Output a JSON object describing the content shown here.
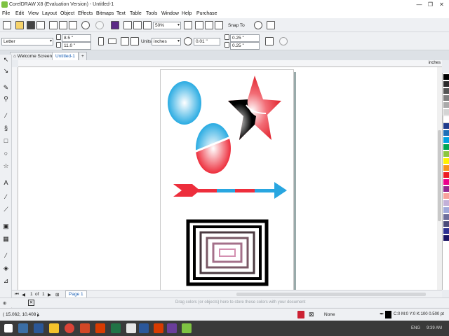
{
  "window": {
    "title": "CorelDRAW X8 (Evaluation Version) - Untitled-1",
    "minimize": "—",
    "maximize": "❐",
    "close": "✕"
  },
  "menu": [
    "File",
    "Edit",
    "View",
    "Layout",
    "Object",
    "Effects",
    "Bitmaps",
    "Text",
    "Table",
    "Tools",
    "Window",
    "Help",
    "Purchase"
  ],
  "toolbar": {
    "zoom": "50%",
    "snap_to": "Snap To"
  },
  "property_bar": {
    "page_size": "Letter",
    "width": "8.5 \"",
    "height": "11.0 \"",
    "units_label": "Units:",
    "units": "inches",
    "nudge": "0.01 \"",
    "dup_x": "0.25 \"",
    "dup_y": "0.25 \""
  },
  "tabs": {
    "welcome": "Welcome Screen",
    "document": "Untitled-1",
    "add": "+"
  },
  "ruler": {
    "unit_label": "inches"
  },
  "page_nav": {
    "current": "1",
    "of_label": "of",
    "total": "1",
    "page_tab": "Page 1"
  },
  "colorbar": {
    "hint": "Drag colors (or objects) here to store these colors with your document"
  },
  "status": {
    "coordinates": "( 15.062, 10.408 )",
    "fill_label": "None",
    "outline": "C:0 M:0 Y:0 K:100  0.500 pt"
  },
  "taskbar": {
    "lang": "ENG",
    "time": "9:39 AM"
  },
  "palette_colors": [
    "#000000",
    "#2b2b2b",
    "#555555",
    "#7f7f7f",
    "#aaaaaa",
    "#d4d4d4",
    "#ffffff",
    "#1f3b8c",
    "#1d6fb8",
    "#00a0e0",
    "#00a651",
    "#8dc63f",
    "#fff200",
    "#f7941d",
    "#ed1c24",
    "#ec008c",
    "#92278f",
    "#f9a19a",
    "#c2b0d8",
    "#9fa8da",
    "#6d6e9c",
    "#4b4b7a",
    "#2e3192",
    "#1b1464"
  ],
  "colors": {
    "accent": "#1a5fb4",
    "circle_blue": "#29abe2",
    "red": "#ed2e3c",
    "arrow_blue": "#29a6e0"
  }
}
